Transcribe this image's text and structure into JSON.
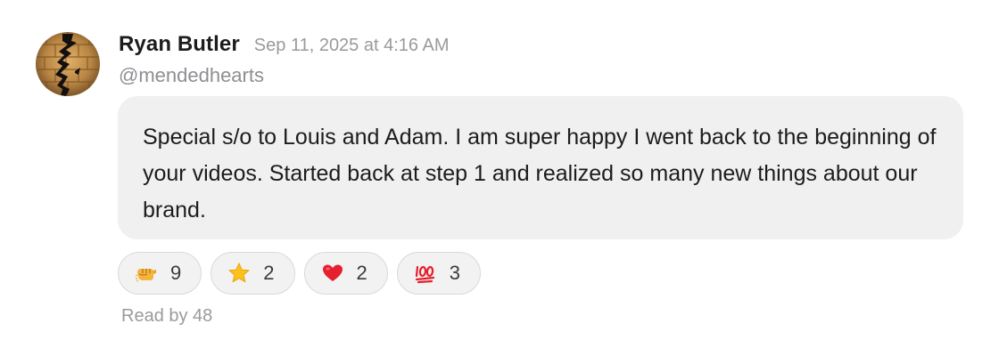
{
  "message": {
    "author_name": "Ryan Butler",
    "timestamp": "Sep 11, 2025 at 4:16 AM",
    "handle": "@mendedhearts",
    "text": "Special s/o to Louis and Adam. I am super happy I went back to the beginning of your videos. Started back at step 1 and realized so many new things about our brand.",
    "avatar_icon": "broken-heart-gold-tiles-avatar"
  },
  "reactions": [
    {
      "icon": "fist-bump-icon",
      "count": "9"
    },
    {
      "icon": "star-icon",
      "count": "2"
    },
    {
      "icon": "red-heart-icon",
      "count": "2"
    },
    {
      "icon": "hundred-points-icon",
      "count": "3"
    }
  ],
  "read_by": "Read by 48",
  "colors": {
    "bubble_background": "#f0f0f0",
    "text_primary": "#1c1c1e",
    "text_secondary": "#9a9a9e",
    "pill_border": "#d9d9d9"
  }
}
